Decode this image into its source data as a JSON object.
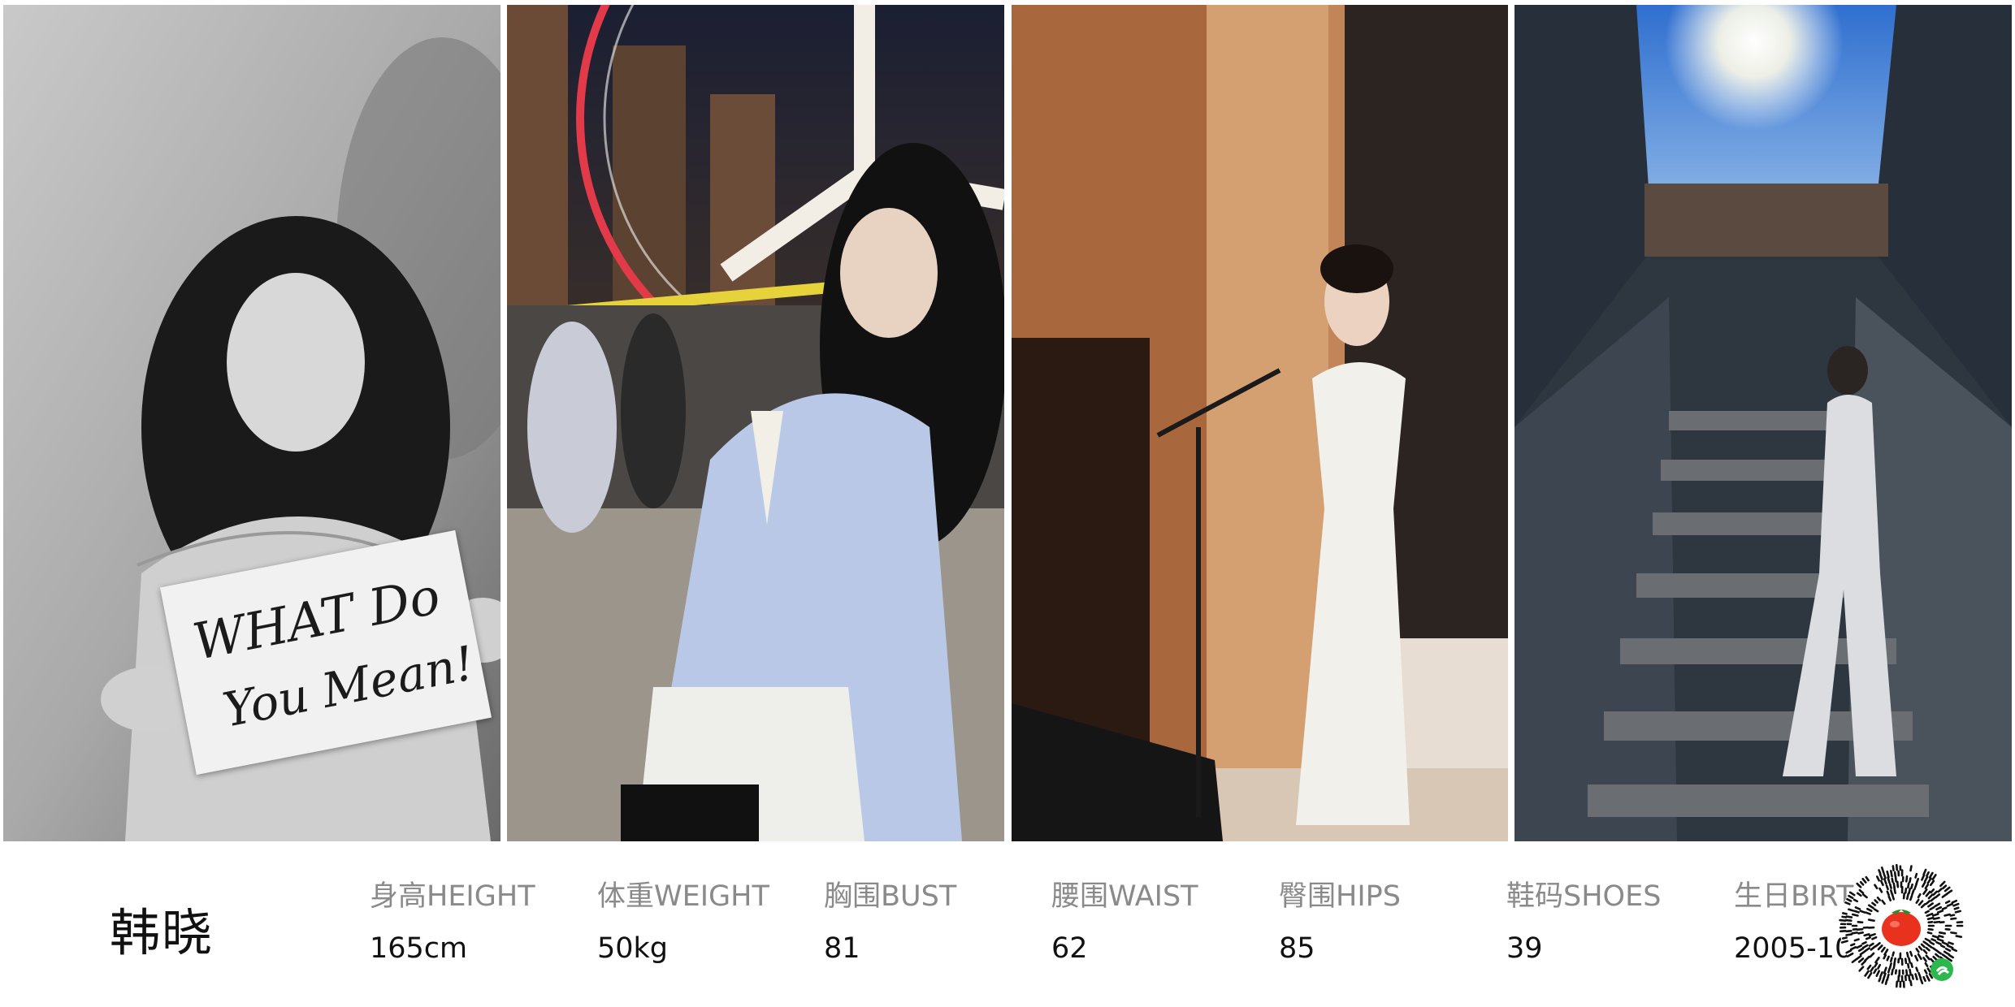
{
  "profile": {
    "name": "韩晓",
    "stats": [
      {
        "label": "身高HEIGHT",
        "value": "165cm"
      },
      {
        "label": "体重WEIGHT",
        "value": "50kg"
      },
      {
        "label": "胸围BUST",
        "value": "81"
      },
      {
        "label": "腰围WAIST",
        "value": "62"
      },
      {
        "label": "臀围HIPS",
        "value": "85"
      },
      {
        "label": "鞋码SHOES",
        "value": "39"
      },
      {
        "label": "生日BIRTH",
        "value": "2005-10"
      }
    ]
  },
  "photos": [
    {
      "sign_text": [
        "WHAT Do",
        "You Mean!"
      ]
    }
  ],
  "icons": {
    "qr_center": "tomato-icon",
    "qr_badge": "link-icon"
  },
  "colors": {
    "qr_fill": "#111111",
    "tomato": "#e8321e",
    "badge": "#2db84d"
  }
}
